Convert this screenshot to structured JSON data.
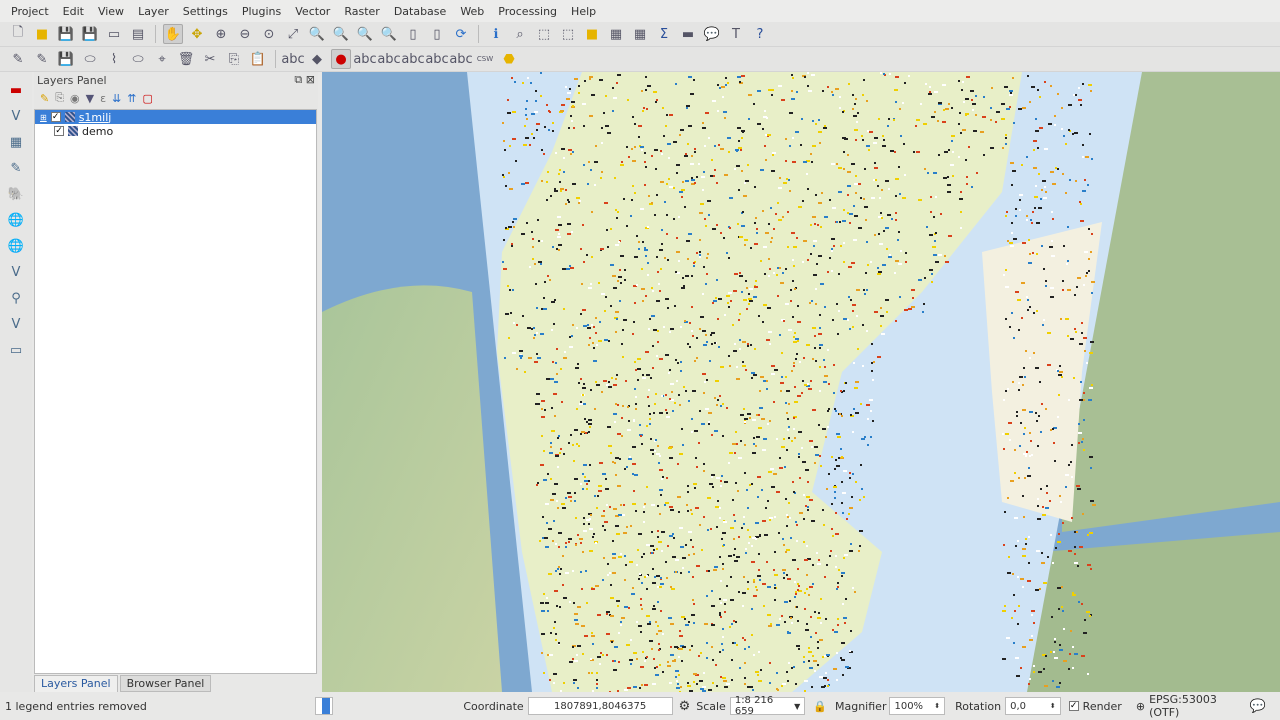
{
  "menu": [
    "Project",
    "Edit",
    "View",
    "Layer",
    "Settings",
    "Plugins",
    "Vector",
    "Raster",
    "Database",
    "Web",
    "Processing",
    "Help"
  ],
  "layers_panel": {
    "title": "Layers Panel",
    "layers": [
      {
        "name": "s1milj",
        "checked": true,
        "selected": true
      },
      {
        "name": "demo",
        "checked": true,
        "selected": false
      }
    ]
  },
  "panel_tabs": [
    "Layers Panel",
    "Browser Panel"
  ],
  "status": {
    "message": "1 legend entries removed",
    "coordinate_label": "Coordinate",
    "coordinate": "1807891,8046375",
    "scale_label": "Scale",
    "scale": "1:8 216 659",
    "magnifier_label": "Magnifier",
    "magnifier": "100%",
    "rotation_label": "Rotation",
    "rotation": "0,0",
    "render_label": "Render",
    "crs": "EPSG:53003 (OTF)"
  },
  "colors": {
    "selection": "#3a7fd8",
    "sea": "#7fa9cf",
    "raster_bg": "#cfe3f5",
    "land": "#e9efc9"
  }
}
